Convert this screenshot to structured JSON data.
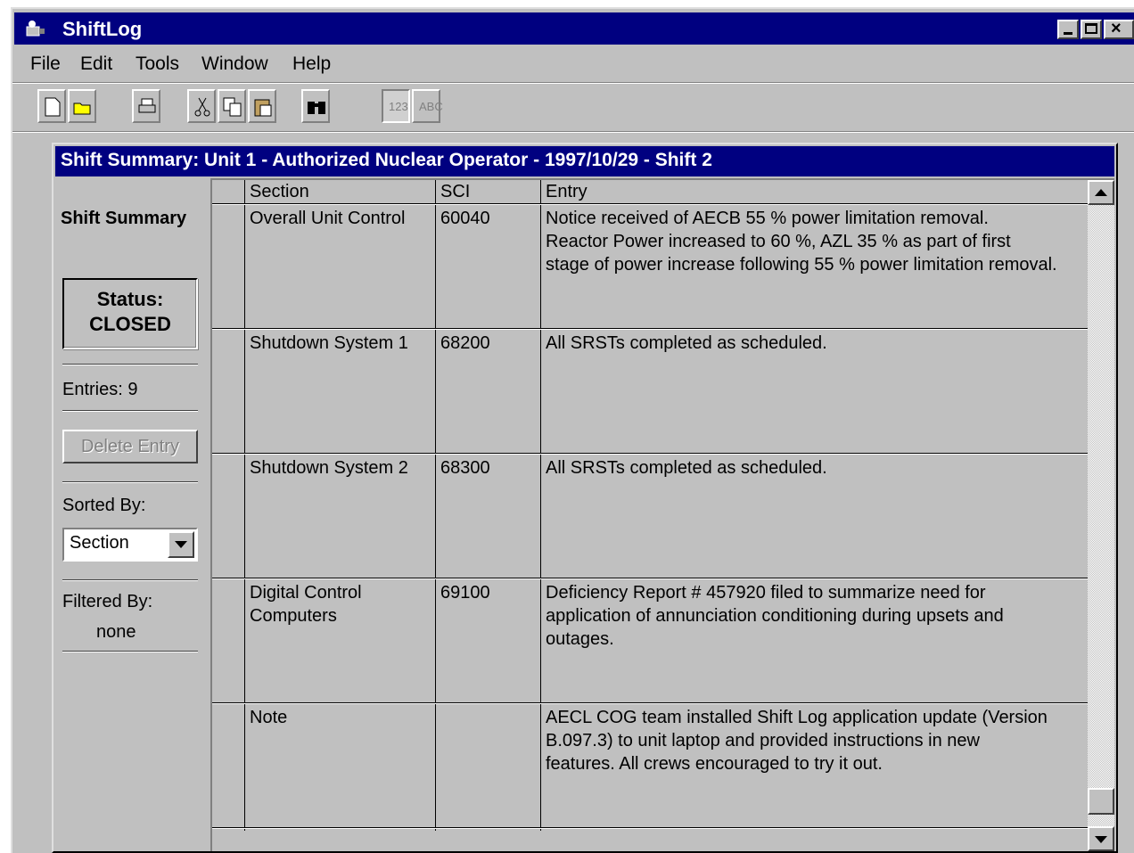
{
  "window": {
    "title": "ShiftLog"
  },
  "menu": [
    "File",
    "Edit",
    "Tools",
    "Window",
    "Help"
  ],
  "toolbar": {
    "icons": [
      "new-document-icon",
      "open-folder-icon",
      "print-icon",
      "cut-icon",
      "copy-icon",
      "paste-icon",
      "find-binoculars-icon",
      "numbering-icon",
      "abc-icon"
    ],
    "numbering_label": "123",
    "abc_label": "ABC"
  },
  "child": {
    "title": "Shift Summary:  Unit 1 - Authorized Nuclear Operator - 1997/10/29 - Shift  2"
  },
  "left_panel": {
    "heading": "Shift Summary",
    "status_label": "Status:",
    "status_value": "CLOSED",
    "entries": "Entries:  9",
    "delete_button": "Delete Entry",
    "sorted_label": "Sorted By:",
    "sorted_value": "Section",
    "filtered_label": "Filtered By:",
    "filtered_value": "none"
  },
  "grid": {
    "columns": [
      "Section",
      "SCI",
      "Entry"
    ],
    "rows": [
      {
        "section": "Overall Unit Control",
        "sci": "60040",
        "entry": "Notice received of AECB 55 % power limitation removal.\nReactor Power increased to 60 %, AZL 35 % as part of first\nstage of power increase following 55 % power limitation removal."
      },
      {
        "section": "Shutdown System 1",
        "sci": "68200",
        "entry": "All SRSTs completed as scheduled."
      },
      {
        "section": "Shutdown System 2",
        "sci": "68300",
        "entry": "All SRSTs completed as scheduled."
      },
      {
        "section": "Digital Control\nComputers",
        "sci": "69100",
        "entry": "Deficiency Report # 457920 filed to summarize need for\napplication of annunciation conditioning during upsets and\noutages."
      },
      {
        "section": "Note",
        "sci": "",
        "entry": "AECL COG team installed Shift Log application update (Version\nB.097.3) to unit laptop and provided instructions in new\nfeatures.  All crews encouraged to try it out."
      }
    ]
  },
  "colors": {
    "title_bar": "#000080",
    "face": "#c0c0c0"
  }
}
